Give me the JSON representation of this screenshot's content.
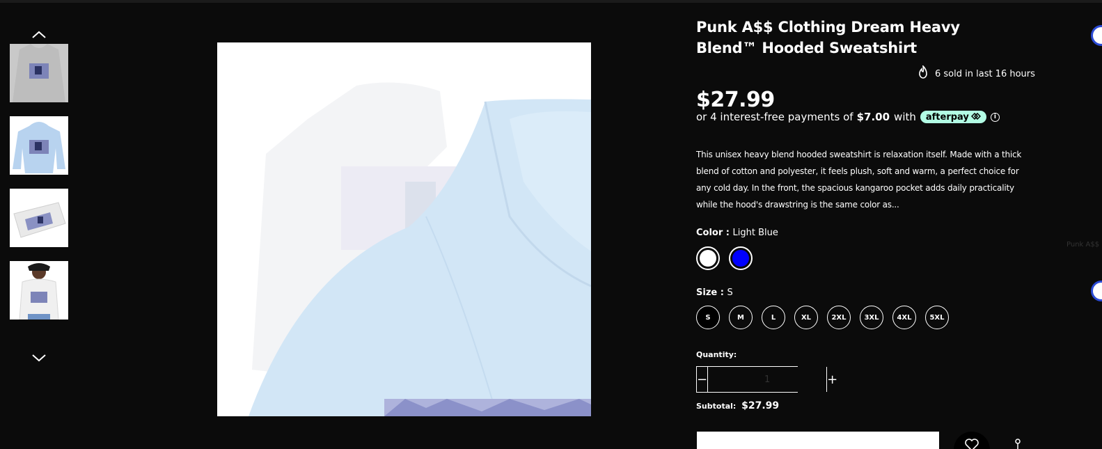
{
  "product": {
    "title": "Punk A$$ Clothing Dream Heavy Blend™ Hooded Sweatshirt",
    "sold_text": "6 sold in last 16 hours",
    "price": "$27.99",
    "installments_prefix": "or 4 interest-free payments of",
    "installments_amount": "$7.00",
    "installments_suffix": "with",
    "afterpay_label": "afterpay",
    "info_icon_glyph": "i",
    "description": "This unisex heavy blend hooded sweatshirt is relaxation itself. Made with a thick blend of cotton and polyester, it feels plush, soft and warm, a perfect choice for any cold day. In the front, the spacious kangaroo pocket adds daily practicality while the hood's drawstring is the same color as..."
  },
  "color": {
    "label": "Color :",
    "selected": "Light Blue",
    "swatches": [
      {
        "name": "White",
        "hex": "#ffffff"
      },
      {
        "name": "Blue",
        "hex": "#0000ff"
      }
    ]
  },
  "size": {
    "label": "Size :",
    "selected": "S",
    "options": [
      "S",
      "M",
      "L",
      "XL",
      "2XL",
      "3XL",
      "4XL",
      "5XL"
    ]
  },
  "quantity": {
    "label": "Quantity:",
    "value": "1",
    "minus": "−",
    "plus": "+"
  },
  "subtotal": {
    "label": "Subtotal:",
    "value": "$27.99"
  },
  "edge_text": "Punk A$$",
  "thumbnails": [
    {
      "name": "thumb-grey-hoodie",
      "color": "#c9c9c9"
    },
    {
      "name": "thumb-light-blue-hoodie",
      "color": "#cfe3f5"
    },
    {
      "name": "thumb-folded-hoodie",
      "color": "#f2f2f2"
    },
    {
      "name": "thumb-model-hoodie",
      "color": "#f4f4f4"
    }
  ],
  "colors": {
    "background": "#0b0b0b",
    "afterpay": "#b2fce4",
    "hoodie_light_blue": "#d2e6f6"
  }
}
